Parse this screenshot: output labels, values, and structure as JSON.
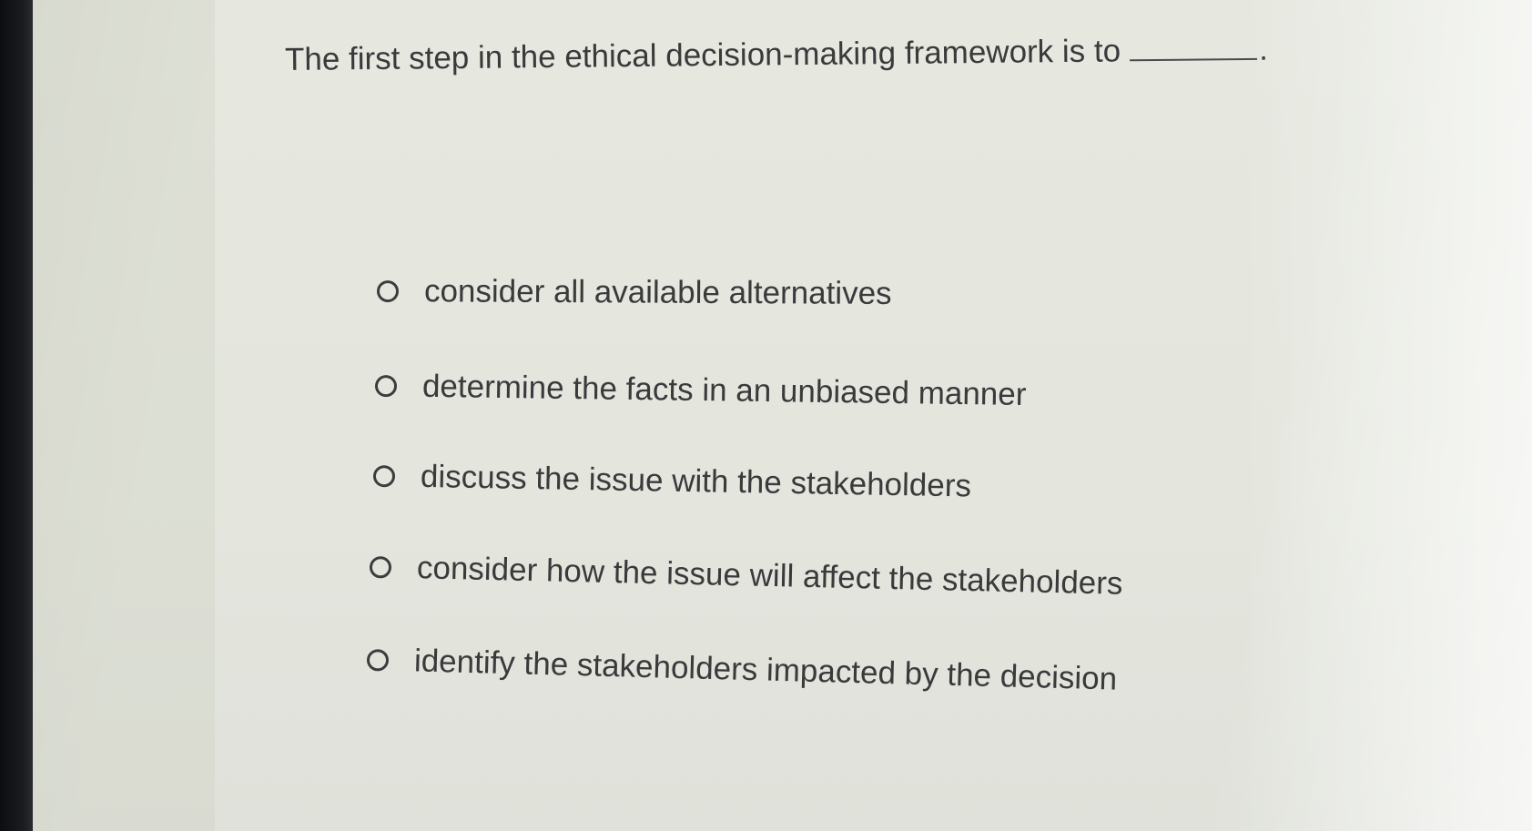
{
  "question": {
    "text": "The first step in the ethical decision-making framework is to",
    "blank_suffix": "."
  },
  "options": [
    {
      "label": "consider all available alternatives",
      "selected": false
    },
    {
      "label": "determine the facts in an unbiased manner",
      "selected": false
    },
    {
      "label": "discuss the issue with the stakeholders",
      "selected": false
    },
    {
      "label": "consider how the issue will affect the stakeholders",
      "selected": false
    },
    {
      "label": "identify the stakeholders impacted by the decision",
      "selected": false
    }
  ],
  "colors": {
    "text": "#3a3a3c",
    "background": "#e4e6df",
    "bezel": "#141518"
  }
}
